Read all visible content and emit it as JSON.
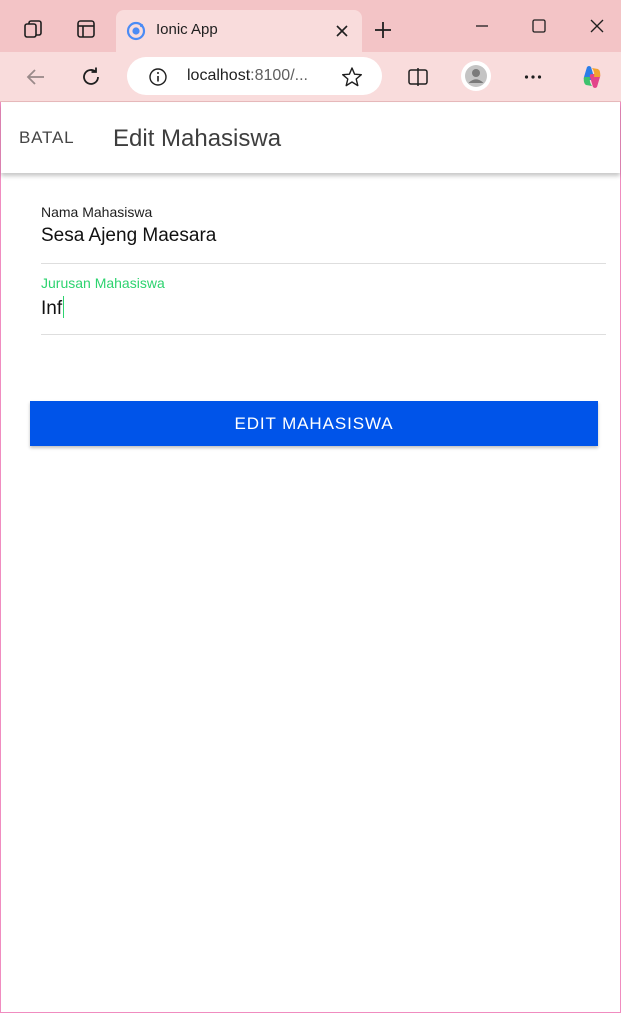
{
  "browser": {
    "tab_title": "Ionic App",
    "url_host": "localhost",
    "url_rest": ":8100/...",
    "icons": [
      "collections-icon",
      "tab-actions-icon",
      "ionic-favicon-icon",
      "close-tab-icon",
      "new-tab-icon",
      "minimize-icon",
      "maximize-icon",
      "close-window-icon",
      "back-icon",
      "refresh-icon",
      "site-info-icon",
      "favorite-star-icon",
      "split-screen-icon",
      "profile-icon",
      "more-icon",
      "copilot-icon"
    ],
    "colors": {
      "tabstrip": "#f3c4c6",
      "active_tab": "#f9dcdc"
    }
  },
  "header": {
    "back_label": "BATAL",
    "title": "Edit Mahasiswa"
  },
  "form": {
    "nama_label": "Nama Mahasiswa",
    "nama_value": "Sesa Ajeng Maesara",
    "jurusan_label": "Jurusan Mahasiswa",
    "jurusan_value": "Inf",
    "submit_label": "EDIT MAHASISWA"
  },
  "colors": {
    "primary": "#0054e9",
    "focus_label": "#2dd36f"
  }
}
